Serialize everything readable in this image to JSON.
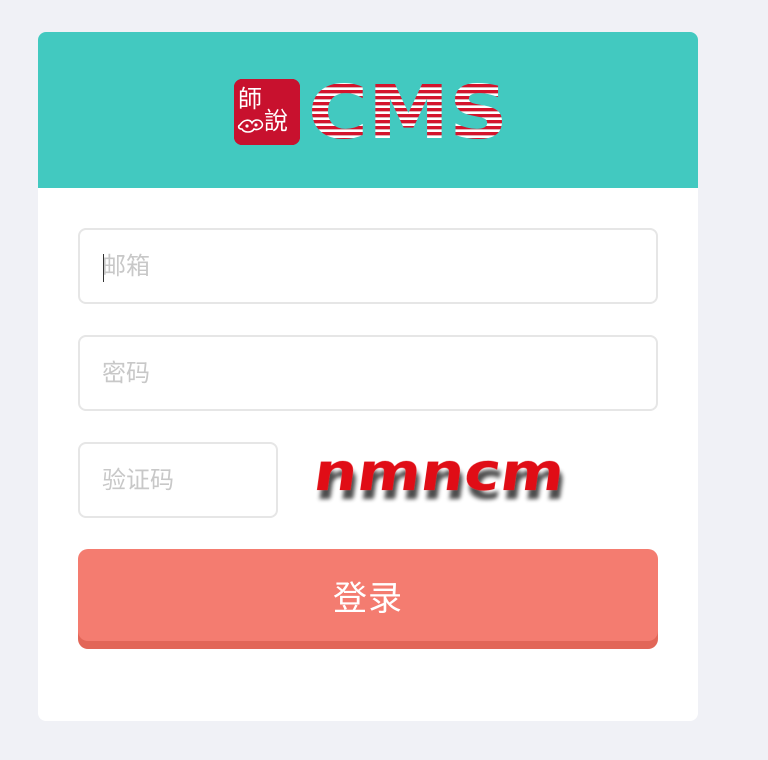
{
  "logo": {
    "seal_text": "師說",
    "wordmark": "CMS",
    "brand_color": "#c8112e",
    "header_color": "#42c9c0"
  },
  "form": {
    "email": {
      "placeholder": "邮箱",
      "value": ""
    },
    "password": {
      "placeholder": "密码",
      "value": ""
    },
    "captcha": {
      "placeholder": "验证码",
      "value": "",
      "image_text": "nmncm"
    },
    "submit_label": "登录",
    "submit_color": "#f47c70"
  }
}
